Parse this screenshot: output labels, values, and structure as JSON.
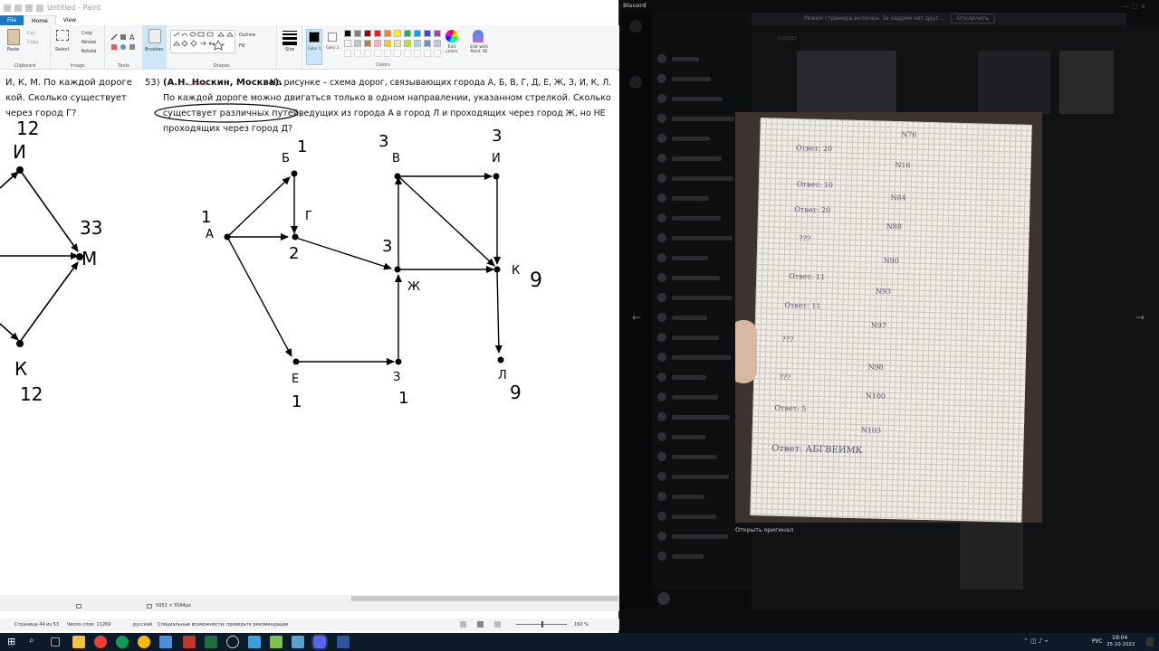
{
  "paint": {
    "title": "Untitled - Paint",
    "menu": [
      "File",
      "Home",
      "View"
    ],
    "clipboard": {
      "paste": "Paste",
      "cut": "Cut",
      "copy": "Copy",
      "label": "Clipboard"
    },
    "image": {
      "select": "Select",
      "crop": "Crop",
      "resize": "Resize",
      "rotate": "Rotate",
      "label": "Image"
    },
    "tools": {
      "label": "Tools",
      "brushes": "Brushes"
    },
    "shapes": {
      "outline": "Outline",
      "fill": "Fill",
      "label": "Shapes"
    },
    "size_label": "Size",
    "color1": "Color 1",
    "color2": "Color 2",
    "colors_label": "Colors",
    "edit_colors": "Edit colors",
    "edit_paint3d": "Edit with Paint 3D",
    "status_size": "5952 × 5584px",
    "palette": [
      "#000000",
      "#7f7f7f",
      "#880015",
      "#ed1c24",
      "#ff7f27",
      "#fff200",
      "#22b14c",
      "#00a2e8",
      "#3f48cc",
      "#a349a4",
      "#ffffff",
      "#c3c3c3",
      "#b97a57",
      "#ffaec9",
      "#ffc90e",
      "#efe4b0",
      "#b5e61d",
      "#99d9ea",
      "#7092be",
      "#c8bfe7"
    ]
  },
  "doc": {
    "left_line1": "И, К, М. По каждой дороге",
    "left_line2": "кой. Сколько существует",
    "left_line3": "через город Г?",
    "q_num": "53)",
    "q_line1_author": "(А.Н. Носкин, Москва).",
    "q_line1_rest": "На рисунке – схема дорог, связывающих города А, Б, В, Г, Д, Е, Ж, З, И, К, Л.",
    "q_line2": "По каждой дороге можно двигаться только в одном направлении, указанном стрелкой. Сколько",
    "q_line3_circled": "существует различных путей,",
    "q_line3_rest": "ведущих из города А в город Л и проходящих через город Ж, но НЕ",
    "q_line4": "проходящих через город Д?"
  },
  "left_graph": {
    "nodes": [
      "И",
      "М",
      "К"
    ],
    "counts": {
      "И": "12",
      "М": "33",
      "К": "12"
    }
  },
  "graph": {
    "nodes": [
      "А",
      "Б",
      "Г",
      "В",
      "И",
      "Ж",
      "К",
      "Е",
      "З",
      "Л"
    ],
    "counts": {
      "А": "1",
      "Б": "1",
      "Г": "2",
      "В": "3",
      "И": "3",
      "Ж": "3",
      "К": "9",
      "Е": "1",
      "З": "1",
      "Л": "9"
    }
  },
  "word_status": {
    "page": "Страница 44 из 53",
    "words": "Число слов: 11269",
    "lang": "русский",
    "access": "Специальные возможности: проверьте рекомендации",
    "zoom": "160 %"
  },
  "discord": {
    "app_name": "Discord",
    "banner": "Режим стримера включен. За кадром нет друг...",
    "banner_btn": "Отключить",
    "channel_user": "oleger",
    "open_original": "Открыть оригинал",
    "notebook": {
      "lines_left": [
        "Ответ: 20",
        "Ответ: 10",
        "Ответ: 20",
        "???",
        "Ответ: 11",
        "Ответ: 11",
        "???",
        "???",
        "Ответ: 5"
      ],
      "lines_right": [
        "N76",
        "N16",
        "N84",
        "N88",
        "N90",
        "N93",
        "N97",
        "N98",
        "N100",
        "N103"
      ],
      "final": "Ответ: АБГВЕИМК",
      "top_left": "N76"
    }
  },
  "taskbar": {
    "lang": "РУС",
    "time": "19:04",
    "date": "25.10.2022"
  }
}
